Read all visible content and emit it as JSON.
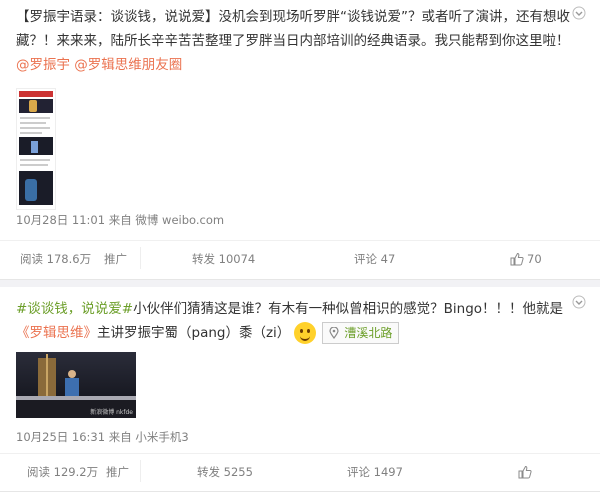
{
  "post1": {
    "text_parts": [
      {
        "kind": "plain",
        "text": "【罗振宇语录：谈谈钱，说说爱】没机会到现场听罗胖“谈钱说爱”？或者听了演讲，还有想收藏？！来来来，陆所长辛辛苦苦整理了罗胖当日内部培训的经典语录。我只能帮到你这里啦！"
      },
      {
        "kind": "link",
        "text": "@罗振宇"
      },
      {
        "kind": "plain",
        "text": " "
      },
      {
        "kind": "link",
        "text": "@罗辑思维朋友圈"
      }
    ],
    "time": "10月28日 11:01",
    "source_prefix": "来自",
    "source": "微博 weibo.com",
    "actions": {
      "reads": "阅读 178.6万",
      "promote": "推广",
      "repost": "转发 10074",
      "comment": "评论 47",
      "likes": "70"
    }
  },
  "post2": {
    "topic1": "#谈谈钱，说说爱#",
    "line1": "小伙伴们猜猜这是谁？有木有一种似曾相识的感觉？Bingo！！！他就是",
    "book": "《罗辑思维》",
    "line2": "主讲罗振宇蜀（pang）黍（zi）",
    "location": "漕溪北路",
    "time": "10月25日 16:31",
    "source_prefix": "来自",
    "source": "小米手机3",
    "watermark": "新浪微博 nkfde",
    "actions": {
      "reads": "阅读 129.2万",
      "promote": "推广",
      "repost": "转发 5255",
      "comment": "评论 1497"
    }
  },
  "colors": {
    "link": "#eb7350",
    "topic": "#6b9e28",
    "meta": "#808080"
  }
}
